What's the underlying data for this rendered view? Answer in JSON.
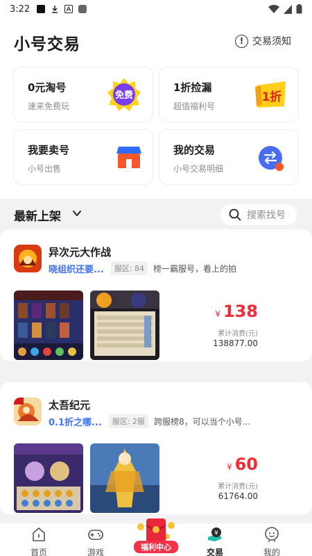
{
  "status_bar": {
    "time": "3:22"
  },
  "header": {
    "title": "小号交易",
    "notice_label": "交易须知",
    "notice_symbol": "!"
  },
  "cards": [
    {
      "title": "0元淘号",
      "subtitle": "速来免费玩",
      "badge": "免费"
    },
    {
      "title": "1折捡漏",
      "subtitle": "超值福利号",
      "badge": "1折"
    },
    {
      "title": "我要卖号",
      "subtitle": "小号出售"
    },
    {
      "title": "我的交易",
      "subtitle": "小号交易明细"
    }
  ],
  "section": {
    "label": "最新上架",
    "search_placeholder": "搜索找号"
  },
  "listings": [
    {
      "name": "异次元大作战",
      "tag": "晓组织还要...",
      "zone": "服区: 84",
      "desc": "榜一霸服号，看上的拍",
      "currency": "¥",
      "price": "138",
      "cum_label": "累计消费(元)",
      "cum_value": "138877.00"
    },
    {
      "name": "太吾纪元",
      "tag": "0.1折之哪...",
      "zone": "服区: 2服",
      "desc": "跨服榜8，可以当个小号...",
      "currency": "¥",
      "price": "60",
      "cum_label": "累计消费(元)",
      "cum_value": "61764.00"
    }
  ],
  "nav": [
    {
      "label": "首页"
    },
    {
      "label": "游戏"
    },
    {
      "label": "福利中心"
    },
    {
      "label": "交易"
    },
    {
      "label": "我的"
    }
  ],
  "colors": {
    "accent_blue": "#3f73f5",
    "price_red": "#ee2c3a",
    "store_orange": "#f4572c",
    "swap_blue": "#4a6cf0"
  }
}
